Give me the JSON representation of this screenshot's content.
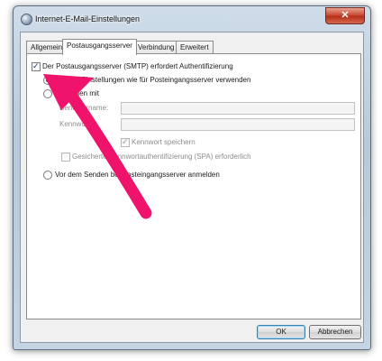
{
  "window": {
    "title": "Internet-E-Mail-Einstellungen",
    "close_glyph": "✕"
  },
  "tabs": [
    "Allgemein",
    "Postausgangsserver",
    "Verbindung",
    "Erweitert"
  ],
  "active_tab": "Postausgangsserver",
  "outgoing": {
    "requires_auth_label": "Der Postausgangsserver (SMTP) erfordert Authentifizierung",
    "requires_auth_checked": true,
    "same_settings_label": "Gleiche Einstellungen wie für Posteingangsserver verwenden",
    "login_with_label": "Anmelden mit",
    "username_label": "Benutzername:",
    "username_value": "",
    "password_label": "Kennwort:",
    "password_value": "",
    "remember_password_label": "Kennwort speichern",
    "remember_password_checked": true,
    "spa_label": "Gesicherte Kennwortauthentifizierung (SPA) erforderlich",
    "spa_checked": false,
    "login_incoming_first_label": "Vor dem Senden bei Posteingangsserver anmelden",
    "selected_option": "same_settings"
  },
  "buttons": {
    "ok": "OK",
    "cancel": "Abbrechen"
  },
  "annotation": {
    "arrow_color": "#f0136b",
    "icon": "pink-arrow-icon"
  }
}
